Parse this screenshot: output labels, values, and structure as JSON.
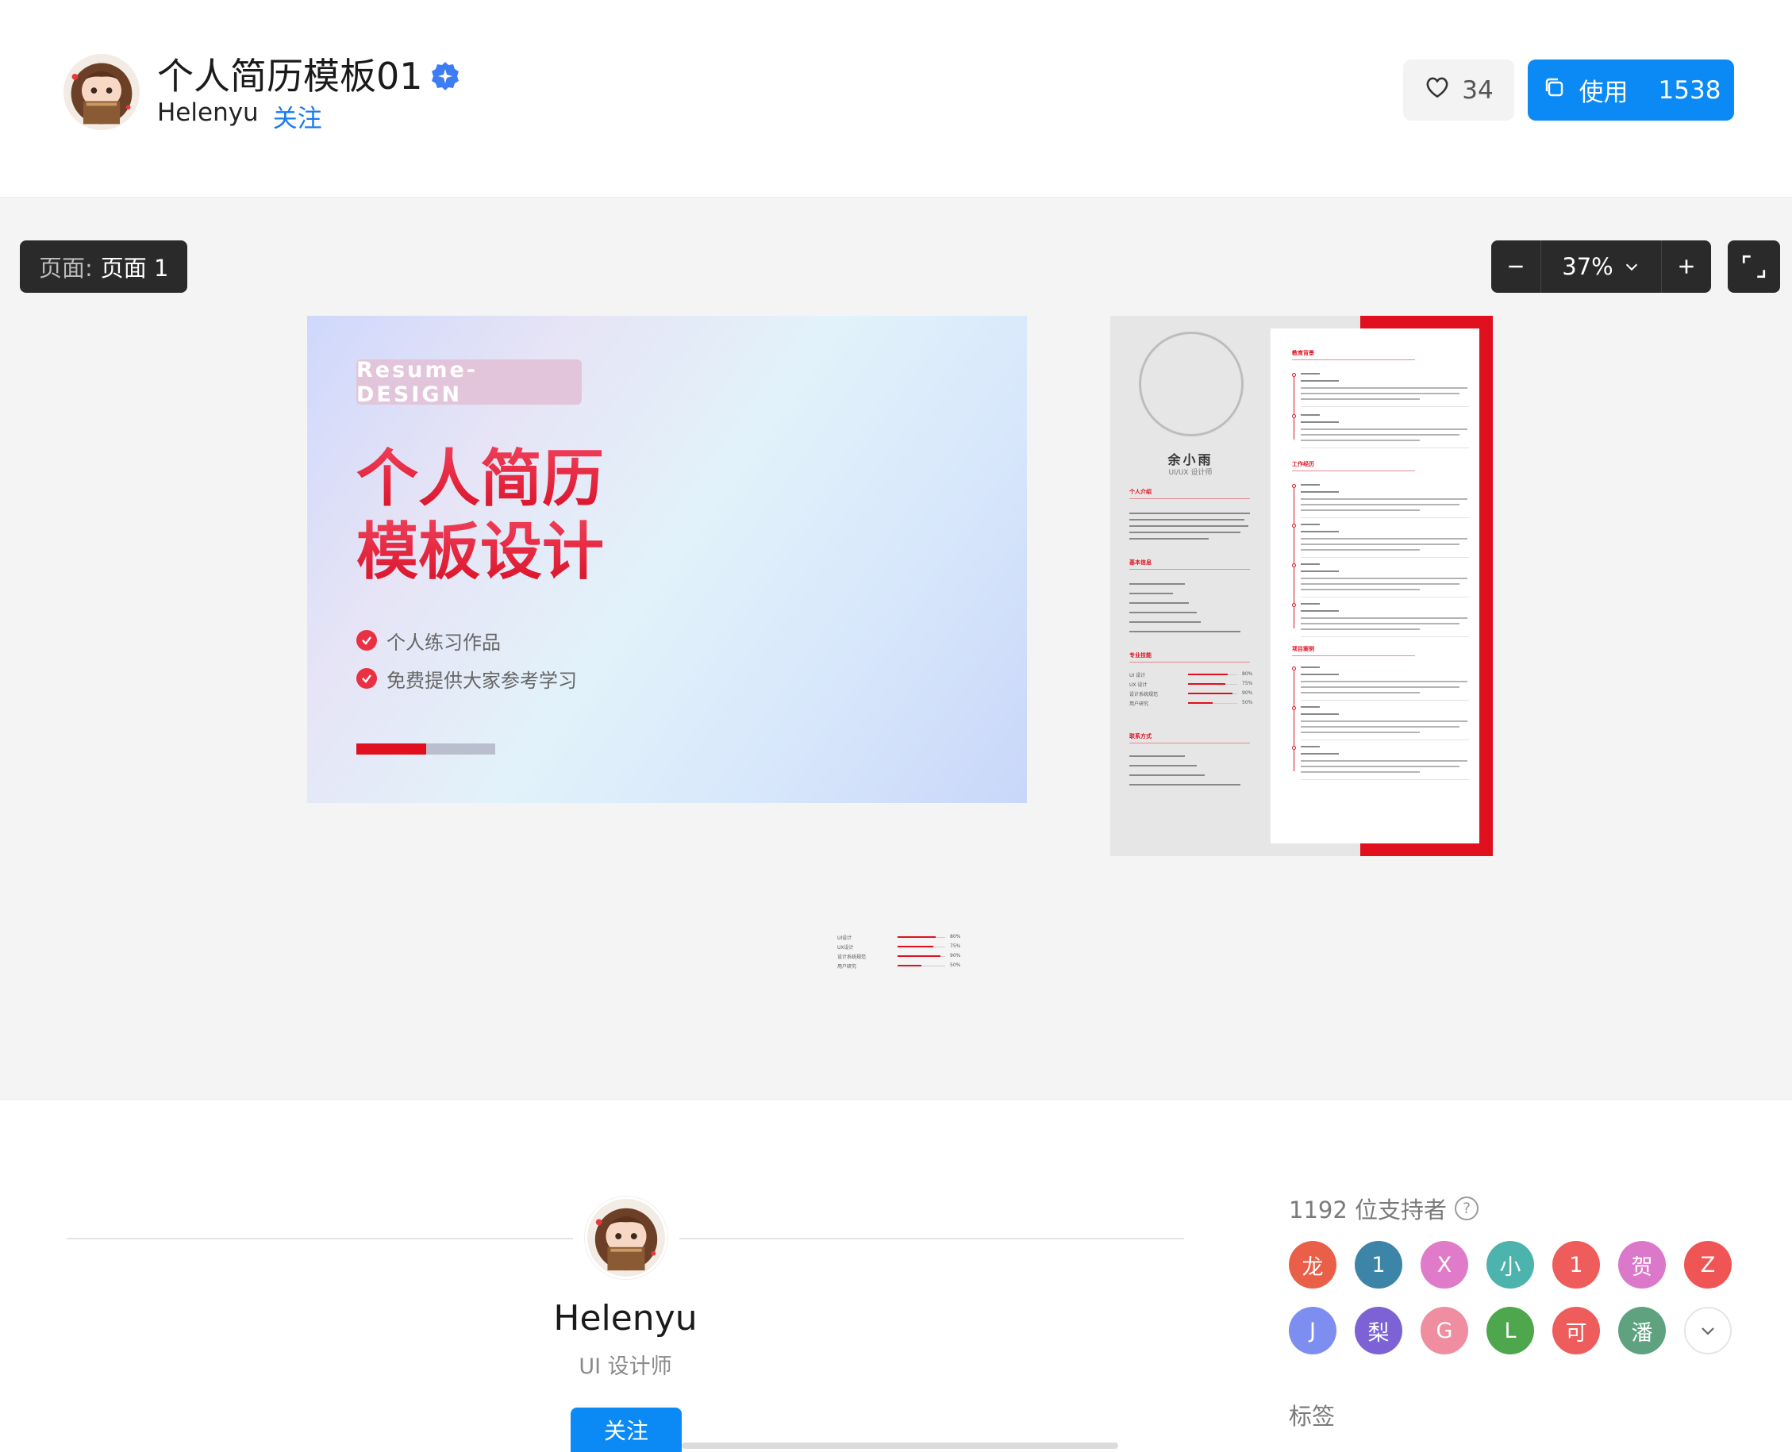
{
  "header": {
    "title": "个人简历模板01",
    "author": "Helenyu",
    "follow_label": "关注",
    "likes": "34",
    "use_label": "使用",
    "use_count": "1538"
  },
  "toolbar": {
    "page_label": "页面:",
    "page_value": "页面 1",
    "zoom_value": "37%"
  },
  "cover": {
    "tag": "Resume-DESIGN",
    "title_line1": "个人简历",
    "title_line2": "模板设计",
    "bullet1": "个人练习作品",
    "bullet2": "免费提供大家参考学习"
  },
  "resume": {
    "name": "余小雨",
    "role": "UI/UX 设计师",
    "sections": {
      "intro": "个人介绍",
      "basic": "基本信息",
      "skills": "专业技能",
      "contact": "联系方式",
      "education": "教育背景",
      "work": "工作经历",
      "projects": "项目案例"
    },
    "skills": [
      {
        "name": "UI 设计",
        "pct": "80%"
      },
      {
        "name": "UX 设计",
        "pct": "75%"
      },
      {
        "name": "设计系统规范",
        "pct": "90%"
      },
      {
        "name": "用户研究",
        "pct": "50%"
      }
    ]
  },
  "mini_skills": [
    {
      "name": "UI设计",
      "pct": "80%"
    },
    {
      "name": "UX设计",
      "pct": "75%"
    },
    {
      "name": "设计系统规范",
      "pct": "90%"
    },
    {
      "name": "用户研究",
      "pct": "50%"
    }
  ],
  "creator": {
    "name": "Helenyu",
    "role": "UI 设计师",
    "follow_label": "关注"
  },
  "supporters": {
    "count_label": "1192 位支持者",
    "help": "?",
    "items": [
      {
        "char": "龙",
        "color": "#e95f47"
      },
      {
        "char": "1",
        "color": "#3c84a8"
      },
      {
        "char": "X",
        "color": "#e07bc9"
      },
      {
        "char": "小",
        "color": "#4cb3ad"
      },
      {
        "char": "1",
        "color": "#ef5c5c"
      },
      {
        "char": "贺",
        "color": "#db78c9"
      },
      {
        "char": "Z",
        "color": "#ef5555"
      },
      {
        "char": "J",
        "color": "#7d8ef0"
      },
      {
        "char": "梨",
        "color": "#7c62d4"
      },
      {
        "char": "G",
        "color": "#ef8ea0"
      },
      {
        "char": "L",
        "color": "#4ea64d"
      },
      {
        "char": "可",
        "color": "#ef5c5c"
      },
      {
        "char": "潘",
        "color": "#5fa27f"
      }
    ]
  },
  "tags_title": "标签"
}
